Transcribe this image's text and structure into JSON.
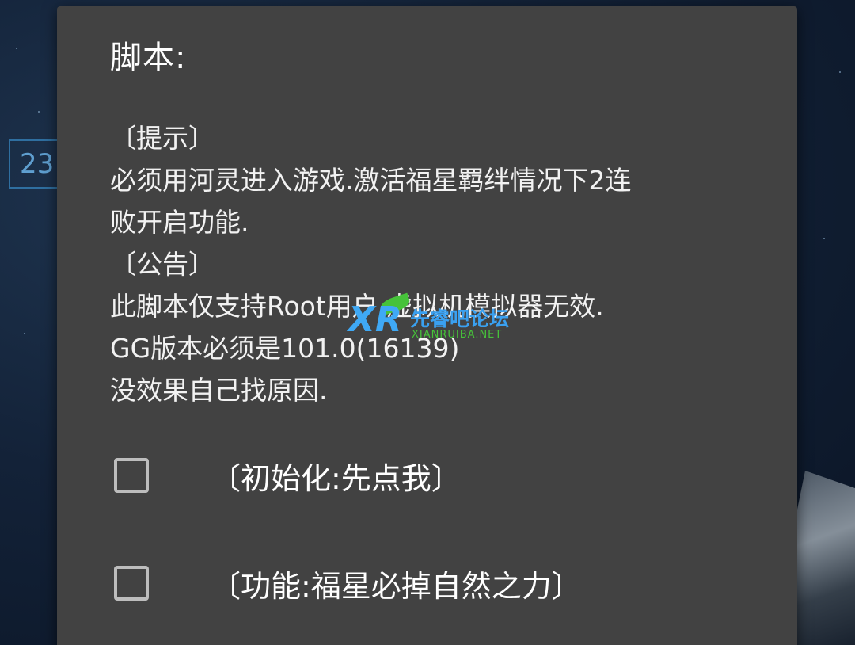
{
  "background": {
    "badge_text": "23"
  },
  "dialog": {
    "title": "脚本:",
    "message_lines": [
      "〔提示〕",
      "必须用河灵进入游戏.激活福星羁绊情况下2连",
      "败开启功能.",
      "〔公告〕",
      "此脚本仅支持Root用户.虚拟机模拟器无效.",
      "GG版本必须是101.0(16139)",
      "没效果自己找原因."
    ],
    "options": [
      {
        "label": "〔初始化:先点我〕",
        "checked": false
      },
      {
        "label": "〔功能:福星必掉自然之力〕",
        "checked": false
      }
    ]
  },
  "watermark": {
    "logo": "XR",
    "site_name": "先睿吧论坛",
    "url": "XIANRUIBA.NET"
  },
  "colors": {
    "dialog_bg": "#424242",
    "text": "#ffffff",
    "checkbox_border": "#bdbdbd",
    "watermark_blue": "#3aa0f0",
    "watermark_green": "#46c23a"
  }
}
